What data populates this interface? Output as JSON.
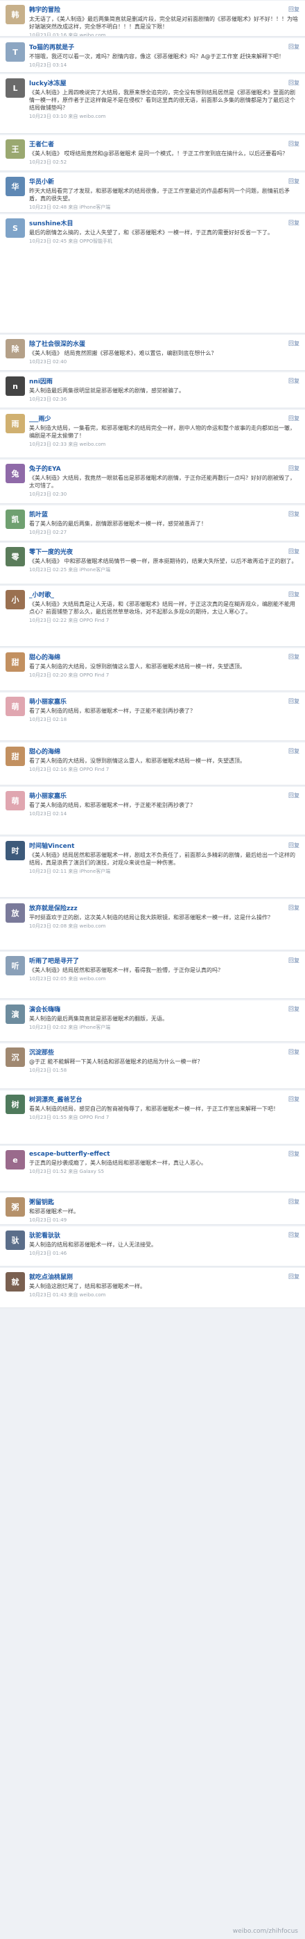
{
  "feed": {
    "reply_label": "回复",
    "watermark": "weibo.com/zhihfocus",
    "posts": [
      {
        "name": "韩宇的冒险",
        "avatar": "韩",
        "color": "#c7b08a",
        "text": "太无语了，《美人制造》最后两集简直就是删减片段，完全就是对前面剧情的《邪恶催眠术》好不好！！！为啥好端端突然改成这样，完全想不明白！！！真是没下限！",
        "time": "10月23日 03:16 来自 weibo.com"
      },
      {
        "name": "To猫的再就是子",
        "avatar": "T",
        "color": "#8ca6c2",
        "text": "不错哦，我还可以看一次，难吗？剧情内容，像这《邪恶催眠术》吗？A@于正工作室 赶快来解释下吧！",
        "time": "10月23日 03:14"
      },
      {
        "name": "lucky冰冻屋",
        "avatar": "L",
        "color": "#6a6a6a",
        "text": "《美人制造》上周四晚说完了大结局，我原来想全追完的，完全没有想到结局居然是《邪恶催眠术》里面的剧情一模一样，原作者于正这样做是不是在侵权？看到这里真的很无语，前面那么多集的剧情都是为了最后这个结局做铺垫吗？",
        "time": "10月23日 03:10 来自 weibo.com"
      },
      {
        "name": "王者仁者",
        "avatar": "王",
        "color": "#9aa870",
        "text": "《美人制造》 哎呀结局竟然和@邪恶催眠术 是同一个模式，！于正工作室到底在搞什么，以后还要看吗？",
        "time": "10月23日 02:52"
      },
      {
        "name": "华员小新",
        "avatar": "华",
        "color": "#5e88b4",
        "text": "昨天大结局看完了才发现，和邪恶催眠术的结局很像，于正工作室最近的作品都有同一个问题，剧情前后矛盾，真的很失望。",
        "time": "10月23日 02:48 来自 iPhone客户端"
      },
      {
        "name": "sunshine木目",
        "avatar": "S",
        "color": "#7ea3c8",
        "text": "最后的剧情怎么搞的，太让人失望了，和《邪恶催眠术》一模一样，于正真的需要好好反省一下了。",
        "time": "10月23日 02:45 来自 OPPO智能手机"
      },
      {
        "name": "除了社会很深的水蛋",
        "avatar": "除",
        "color": "#b4a088",
        "text": "《美人制造》 结局竟然照搬《邪恶催眠术》，难以置信，编剧到底在想什么？",
        "time": "10月23日 02:40"
      },
      {
        "name": "nni因雨",
        "avatar": "n",
        "color": "#444444",
        "text": "美人制造最后两集很明显就是邪恶催眠术的剧情，感觉被骗了。",
        "time": "10月23日 02:36"
      },
      {
        "name": "___雨少",
        "avatar": "雨",
        "color": "#d0b070",
        "text": "美人制造大结局，一集看完，和邪恶催眠术的结局完全一样，剧中人物的命运和整个故事的走向都如出一辙，编剧是不是太偷懒了！",
        "time": "10月23日 02:33 来自 weibo.com"
      },
      {
        "name": "兔子的EYA",
        "avatar": "兔",
        "color": "#8f6aa8",
        "text": "《美人制造》大结局，我竟然一眼就看出是邪恶催眠术的剧情，于正你还能再敷衍一点吗？好好的剧被毁了，太可惜了。",
        "time": "10月23日 02:30"
      },
      {
        "name": "凯叶蓝",
        "avatar": "凯",
        "color": "#6fa070",
        "text": "看了美人制造的最后两集，剧情跟邪恶催眠术一模一样，感觉被愚弄了！",
        "time": "10月23日 02:27"
      },
      {
        "name": "零下一度的光夜",
        "avatar": "零",
        "color": "#5a7c5a",
        "text": "《美人制造》 中和邪恶催眠术结局情节一模一样，原本挺期待的，结果大失所望，以后不敢再追于正的剧了。",
        "time": "10月23日 02:25 来自 iPhone客户端"
      },
      {
        "name": "_小时歌_",
        "avatar": "小",
        "color": "#9a7050",
        "text": "《美人制造》大结局真是让人无语，和《邪恶催眠术》结局一样，于正这次真的是在糊弄观众，编剧能不能用点心？前面铺垫了那么久，最后居然草草收场，对不起那么多观众的期待，太让人寒心了。",
        "time": "10月23日 02:22 来自 OPPO Find 7"
      },
      {
        "name": "甜心的海绵",
        "avatar": "甜",
        "color": "#c29060",
        "text": "看了美人制造的大结局，没想到剧情这么雷人，和邪恶催眠术结局一模一样，失望透顶。",
        "time": "10月23日 02:20 来自 OPPO Find 7"
      },
      {
        "name": "萌小丽家嘉乐",
        "avatar": "萌",
        "color": "#e0a6b0",
        "text": "看了美人制造的结局，和邪恶催眠术一样，于正能不能别再抄袭了？",
        "time": "10月23日 02:18"
      },
      {
        "name": "甜心的海绵",
        "avatar": "甜",
        "color": "#c29060",
        "text": "看了美人制造的大结局，没想到剧情这么雷人，和邪恶催眠术结局一模一样，失望透顶。",
        "time": "10月23日 02:16 来自 OPPO Find 7"
      },
      {
        "name": "萌小丽家嘉乐",
        "avatar": "萌",
        "color": "#e0a6b0",
        "text": "看了美人制造的结局，和邪恶催眠术一样，于正能不能别再抄袭了？",
        "time": "10月23日 02:14"
      },
      {
        "name": "时间轴Vincent",
        "avatar": "时",
        "color": "#3d5a7a",
        "text": "《美人制造》结局居然和邪恶催眠术一样，剧组太不负责任了，前面那么多精彩的剧情，最后给出一个这样的结局，真是浪费了演员们的演技，对观众来说也是一种伤害。",
        "time": "10月23日 02:11 来自 iPhone客户端"
      },
      {
        "name": "放弃就是保险zzz",
        "avatar": "放",
        "color": "#7a7a9a",
        "text": "平时挺喜欢于正的剧，这次美人制造的结局让我大跌眼镜，和邪恶催眠术一模一样，这是什么操作？",
        "time": "10月23日 02:08 来自 weibo.com"
      },
      {
        "name": "听雨了吧是寻开了",
        "avatar": "听",
        "color": "#8aa0b8",
        "text": "《美人制造》结局居然和邪恶催眠术一样，看得我一脸懵，于正你是认真的吗？",
        "time": "10月23日 02:05 来自 weibo.com"
      },
      {
        "name": "演会长嗨嗨",
        "avatar": "演",
        "color": "#6d8c9e",
        "text": "美人制造的最后两集简直就是邪恶催眠术的翻版，无语。",
        "time": "10月23日 02:02 来自 iPhone客户端"
      },
      {
        "name": "沉淀那些",
        "avatar": "沉",
        "color": "#a08870",
        "text": "@于正 能不能解释一下美人制造和邪恶催眠术的结局为什么一模一样？",
        "time": "10月23日 01:58"
      },
      {
        "name": "树洞漂亮_酱爸艺台",
        "avatar": "树",
        "color": "#4f7a5c",
        "text": "看美人制造的结局，感觉自己的智商被侮辱了，和邪恶催眠术一模一样，于正工作室出来解释一下吧！",
        "time": "10月23日 01:55 来自 OPPO Find 7"
      },
      {
        "name": "escape-butterfly-effect",
        "avatar": "e",
        "color": "#9a6a8c",
        "text": "于正真的是抄袭成瘾了，美人制造结局和邪恶催眠术一样，真让人恶心。",
        "time": "10月23日 01:52 来自 Galaxy S5"
      },
      {
        "name": "粥留钥匙",
        "avatar": "粥",
        "color": "#b5916a",
        "text": "和邪恶催眠术一样。",
        "time": "10月23日 01:49"
      },
      {
        "name": "驮驼看驮驮",
        "avatar": "驮",
        "color": "#5b6e8a",
        "text": "美人制造的结局和邪恶催眠术一样，让人无法接受。",
        "time": "10月23日 01:46"
      },
      {
        "name": "就吃点油桃鼠刚",
        "avatar": "就",
        "color": "#7a6050",
        "text": "美人制造这剧烂尾了，结局和邪恶催眠术一样。",
        "time": "10月23日 01:43 来自 weibo.com"
      }
    ]
  }
}
